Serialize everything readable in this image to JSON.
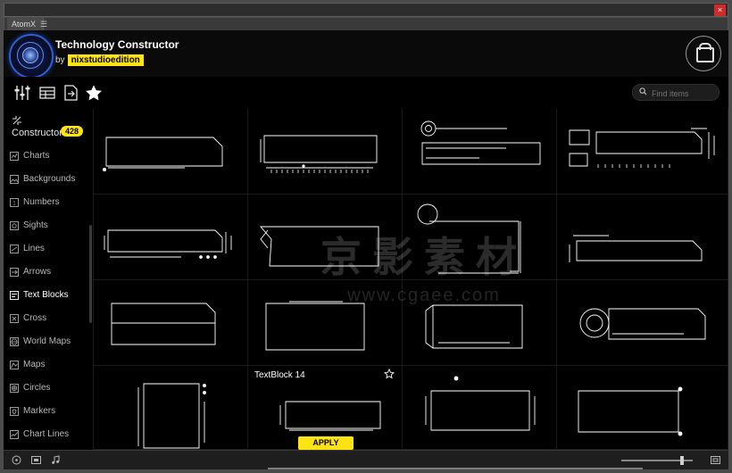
{
  "window": {
    "close_label": "×",
    "tab_label": "AtomX",
    "tab_menu_icon": "hamburger-icon"
  },
  "header": {
    "title": "Technology Constructor",
    "by_prefix": "by",
    "author": "nixstudioedition",
    "cart_icon": "shopping-bag-icon",
    "logo_icon": "atom-logo-icon"
  },
  "toolbar": {
    "items": [
      {
        "name": "sliders-icon",
        "label": "Settings"
      },
      {
        "name": "list-icon",
        "label": "List"
      },
      {
        "name": "export-icon",
        "label": "Export"
      },
      {
        "name": "star-icon",
        "label": "Favorites"
      }
    ],
    "search": {
      "placeholder": "Find items",
      "value": "",
      "icon": "search-icon"
    }
  },
  "sidebar": {
    "header": {
      "icon": "constructor-icon",
      "label": "Constructor",
      "count": "428"
    },
    "items": [
      {
        "label": "Charts",
        "icon": "chart-icon",
        "active": false
      },
      {
        "label": "Backgrounds",
        "icon": "background-icon",
        "active": false
      },
      {
        "label": "Numbers",
        "icon": "numbers-icon",
        "active": false
      },
      {
        "label": "Sights",
        "icon": "sights-icon",
        "active": false
      },
      {
        "label": "Lines",
        "icon": "lines-icon",
        "active": false
      },
      {
        "label": "Arrows",
        "icon": "arrows-icon",
        "active": false
      },
      {
        "label": "Text Blocks",
        "icon": "text-blocks-icon",
        "active": true
      },
      {
        "label": "Cross",
        "icon": "cross-icon",
        "active": false
      },
      {
        "label": "World Maps",
        "icon": "world-maps-icon",
        "active": false
      },
      {
        "label": "Maps",
        "icon": "maps-icon",
        "active": false
      },
      {
        "label": "Circles",
        "icon": "circles-icon",
        "active": false
      },
      {
        "label": "Markers",
        "icon": "markers-icon",
        "active": false
      },
      {
        "label": "Chart Lines",
        "icon": "chart-lines-icon",
        "active": false
      }
    ]
  },
  "grid": {
    "selected_item": {
      "label": "TextBlock 14",
      "star_icon": "star-outline-icon",
      "apply_label": "APPLY",
      "apply_icon": "apply-icon"
    },
    "watermark": {
      "text_cn": "京影素材",
      "text_url": "www.cgaee.com"
    }
  },
  "footer": {
    "left_icons": [
      "target-icon",
      "screen-icon",
      "audio-icon"
    ],
    "right_icons": [
      "fit-icon",
      "fullscreen-icon",
      "expand-icon"
    ],
    "zoom_value": ""
  },
  "colors": {
    "accent_yellow": "#ffe312",
    "background": "#000000",
    "panel": "#0a0a0a",
    "stroke": "#ffffff"
  }
}
